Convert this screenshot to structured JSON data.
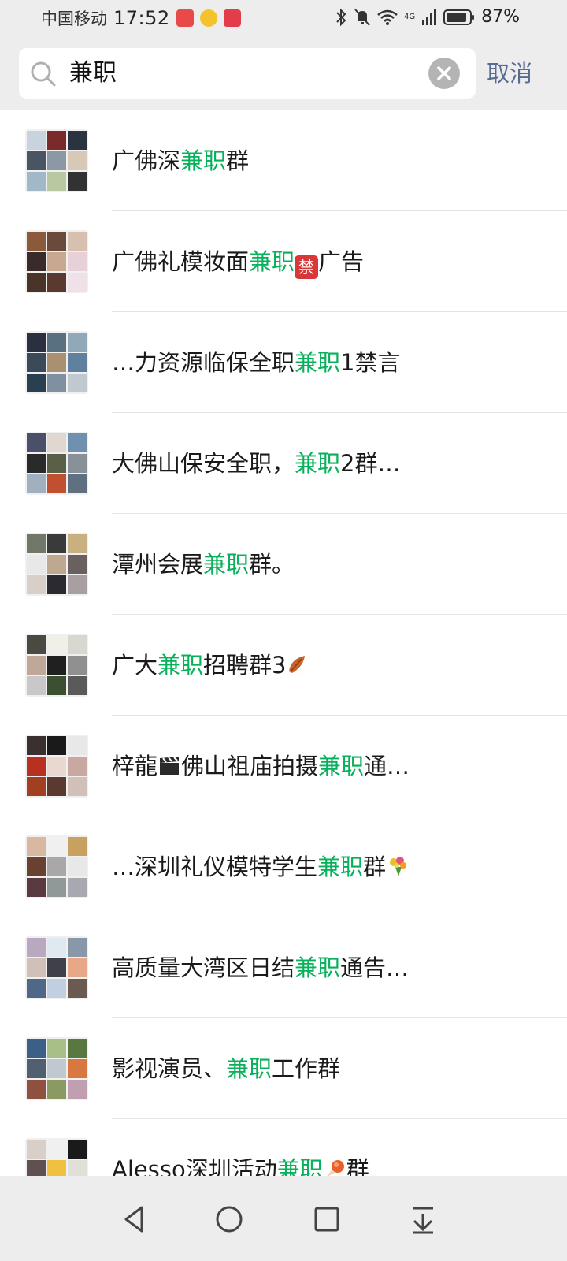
{
  "status_bar": {
    "carrier": "中国移动",
    "time": "17:52",
    "network": "4G",
    "battery": "87%",
    "icons": [
      "huawei-app-icon",
      "weibo-icon",
      "qzone-icon",
      "bluetooth-icon",
      "mute-icon",
      "wifi-icon",
      "signal-icon",
      "battery-icon"
    ]
  },
  "search": {
    "query": "兼职",
    "cancel_label": "取消"
  },
  "colors": {
    "highlight": "#07b05a",
    "link": "#576b95",
    "header_bg": "#ededed"
  },
  "results": [
    {
      "pre": "广佛深",
      "hl": "兼职",
      "post": "群",
      "emoji": ""
    },
    {
      "pre": "广佛礼模妆面",
      "hl": "兼职",
      "post": "广告",
      "emoji": "禁",
      "emoji_pos": "after_hl"
    },
    {
      "pre": "…力资源临保全职",
      "hl": "兼职",
      "post": "1禁言",
      "emoji": ""
    },
    {
      "pre": "大佛山保安全职，",
      "hl": "兼职",
      "post": "2群…",
      "emoji": ""
    },
    {
      "pre": "潭州会展",
      "hl": "兼职",
      "post": "群。",
      "emoji": ""
    },
    {
      "pre": "广大",
      "hl": "兼职",
      "post": "招聘群3",
      "emoji": "leaf",
      "emoji_pos": "end"
    },
    {
      "pre": "梓龍",
      "mid_emoji": "clapper",
      "pre2": "佛山祖庙拍摄",
      "hl": "兼职",
      "post": "通…",
      "emoji": ""
    },
    {
      "pre": "…深圳礼仪模特学生",
      "hl": "兼职",
      "post": "群",
      "emoji": "bouquet",
      "emoji_pos": "end"
    },
    {
      "pre": "高质量大湾区日结",
      "hl": "兼职",
      "post": "通告…",
      "emoji": ""
    },
    {
      "pre": "影视演员、",
      "hl": "兼职",
      "post": "工作群",
      "emoji": ""
    },
    {
      "pre": "Alesso深圳活动",
      "hl": "兼职",
      "post": "群",
      "emoji": "comet",
      "emoji_pos": "after_hl"
    }
  ],
  "nav": [
    "back-icon",
    "home-icon",
    "recents-icon",
    "notification-pull-icon"
  ]
}
